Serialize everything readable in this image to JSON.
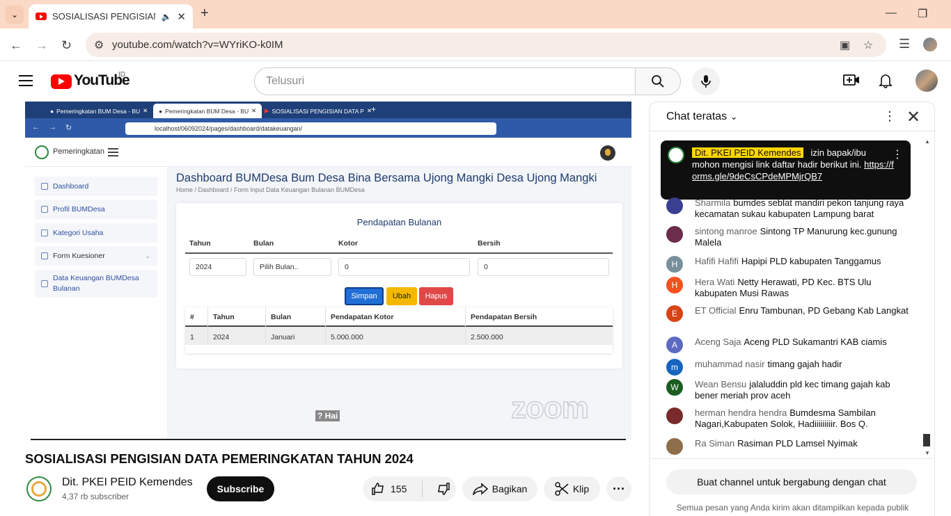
{
  "browser": {
    "tab_title": "SOSIALISASI PENGISIAN DA",
    "url": "youtube.com/watch?v=WYriKO-k0IM"
  },
  "youtube": {
    "logo_text": "YouTube",
    "country": "ID",
    "search_placeholder": "Telusuri"
  },
  "video_frame": {
    "tabs": [
      "Pemeringkatan BUM Desa - BU",
      "Pemeringkatan BUM Desa - BU",
      "SOSIALISASI PENGISIAN DATA P"
    ],
    "url": "localhost/06092024/pages/dashboard/datakeuangan/",
    "brand": "Pemeringkatan",
    "sidebar": [
      "Dashboard",
      "Profil BUMDesa",
      "Kategori Usaha",
      "Form Kuesioner",
      "Data Keuangan BUMDesa Bulanan"
    ],
    "page_title": "Dashboard BUMDesa Bum Desa Bina Bersama Ujong Mangki Desa Ujong Mangki",
    "breadcrumb": "Home  /  Dashboard  /  Form Input Data Keuangan Bulanan BUMDesa",
    "form": {
      "title": "Pendapatan Bulanan",
      "labels": [
        "Tahun",
        "Bulan",
        "Kotor",
        "Bersih"
      ],
      "values": [
        "2024",
        "Pilih Bulan..",
        "0",
        "0"
      ],
      "buttons": [
        "Simpan",
        "Ubah",
        "Hapus"
      ]
    },
    "table": {
      "headers": [
        "#",
        "Tahun",
        "Bulan",
        "Pendapatan Kotor",
        "Pendapatan Bersih"
      ],
      "row": [
        "1",
        "2024",
        "Januari",
        "5.000.000",
        "2.500.000"
      ]
    },
    "caption": "? Hai",
    "watermark": "zoom"
  },
  "video": {
    "title": "SOSIALISASI PENGISIAN DATA PEMERINGKATAN TAHUN 2024",
    "channel": "Dit. PKEI PEID Kemendes",
    "subscribers": "4,37 rb subscriber",
    "subscribe_label": "Subscribe",
    "likes": "155",
    "share_label": "Bagikan",
    "clip_label": "Klip"
  },
  "chat": {
    "title": "Chat teratas",
    "pinned": {
      "author": "Dit. PKEI PEID Kemendes",
      "text": "izin bapak/ibu mohon mengisi link daftar hadir berikut ini.",
      "link": "https://forms.gle/9deCsCPdeMPMjrQB7"
    },
    "messages": [
      {
        "initial": "",
        "color": "#3b3f8f",
        "author": "Sharmila",
        "text": "bumdes seblat mandiri pekon tanjung raya kecamatan sukau kabupaten Lampung barat"
      },
      {
        "initial": "",
        "color": "#6b2d4a",
        "author": "sintong manroe",
        "text": "Sintong TP Manurung kec.gunung Malela"
      },
      {
        "initial": "H",
        "color": "#78909c",
        "author": "Hafifi Hafifi",
        "text": "Hapipi PLD kabupaten Tanggamus"
      },
      {
        "initial": "H",
        "color": "#f4511e",
        "author": "Hera Wati",
        "text": "Netty Herawati, PD Kec. BTS Ulu kabupaten Musi Rawas"
      },
      {
        "initial": "E",
        "color": "#d84315",
        "author": "ET Official",
        "text": "Enru Tambunan, PD Gebang Kab Langkat"
      },
      {
        "initial": "A",
        "color": "#5c6bc0",
        "author": "Aceng Saja",
        "text": "Aceng PLD Sukamantri KAB ciamis"
      },
      {
        "initial": "m",
        "color": "#1565c0",
        "author": "muhammad nasir",
        "text": "timang gajah hadir"
      },
      {
        "initial": "W",
        "color": "#1b5e20",
        "author": "Wean Bensu",
        "text": "jalaluddin pld kec timang gajah kab bener meriah prov aceh"
      },
      {
        "initial": "",
        "color": "#7a2a2a",
        "author": "herman hendra hendra",
        "text": "Bumdesma Sambilan Nagari,Kabupaten Solok, Hadiiiiiiiiir. Bos Q."
      },
      {
        "initial": "",
        "color": "#8d6e4a",
        "author": "Ra Siman",
        "text": "Rasiman PLD Lamsel Nyimak"
      }
    ],
    "join_label": "Buat channel untuk bergabung dengan chat",
    "footer_note": "Semua pesan yang Anda kirim akan ditampilkan kepada publik"
  }
}
